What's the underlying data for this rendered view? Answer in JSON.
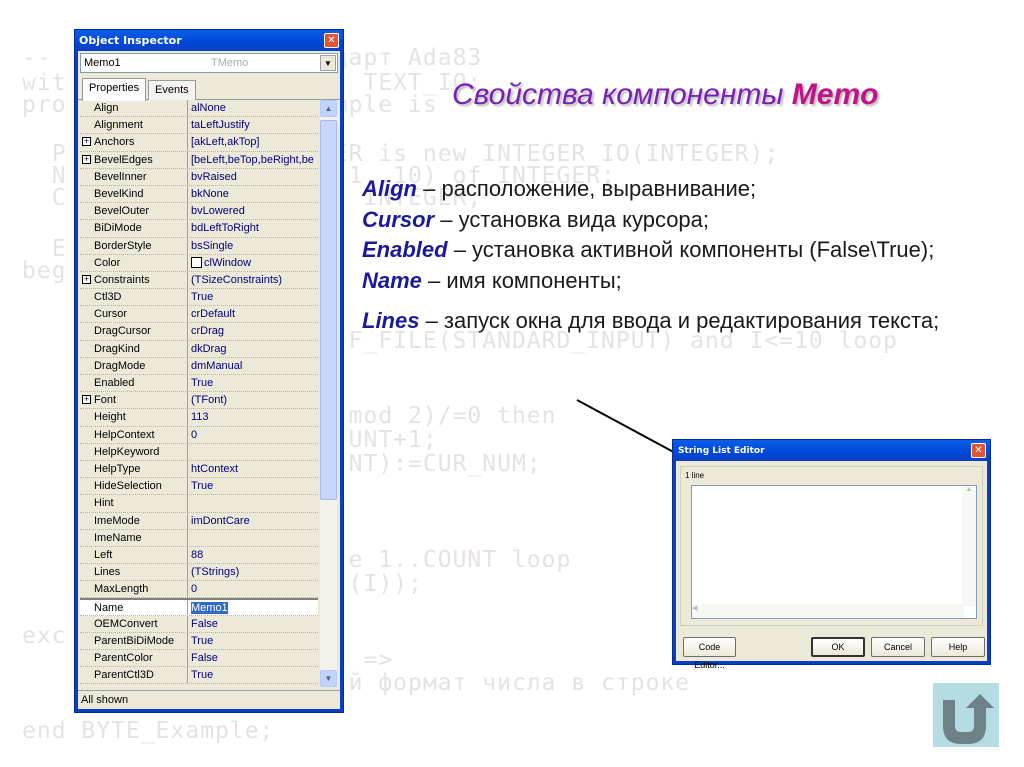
{
  "background_code": [
    "-- Используется стандарт Ada83",
    "with ADA.TEXT_IO; use ADA.TEXT_IO;",
    "procedure BYTE_Example is",
    "  package INT_IO is new INTEGER_IO(INTEGER);",
    "  NUMS: array (1..10) of INTEGER;",
    "  CUR_NUM: INTEGER;",
    "  E",
    "begin",
    "  while not END_OF_FILE(STANDARD_INPUT) and I<=10 loop",
    "    if (CUR_NUM mod 2)/=0 then",
    "      COUNT:=COUNT+1;",
    "      NUMS(COUNT):=CUR_NUM;",
    "    for I in reverse 1..COUNT loop",
    "      PUT(NUMS(I));",
    "exception",
    "  when DATA_ERROR =>",
    "    PUT_LINE(\"Неверный формат числа в строке\");",
    "end BYTE_Example;"
  ],
  "object_inspector": {
    "title": "Object Inspector",
    "close_glyph": "✕",
    "component_name": "Memo1",
    "component_type": "TMemo",
    "dropdown_glyph": "▼",
    "tabs": [
      "Properties",
      "Events"
    ],
    "active_tab": "Properties",
    "status": "All shown",
    "properties": [
      {
        "name": "Align",
        "value": "alNone",
        "expandable": false
      },
      {
        "name": "Alignment",
        "value": "taLeftJustify",
        "expandable": false
      },
      {
        "name": "Anchors",
        "value": "[akLeft,akTop]",
        "expandable": true
      },
      {
        "name": "BevelEdges",
        "value": "[beLeft,beTop,beRight,be",
        "expandable": true
      },
      {
        "name": "BevelInner",
        "value": "bvRaised",
        "expandable": false
      },
      {
        "name": "BevelKind",
        "value": "bkNone",
        "expandable": false
      },
      {
        "name": "BevelOuter",
        "value": "bvLowered",
        "expandable": false
      },
      {
        "name": "BiDiMode",
        "value": "bdLeftToRight",
        "expandable": false
      },
      {
        "name": "BorderStyle",
        "value": "bsSingle",
        "expandable": false
      },
      {
        "name": "Color",
        "value": "clWindow",
        "expandable": false,
        "swatch": "#ffffff"
      },
      {
        "name": "Constraints",
        "value": "(TSizeConstraints)",
        "expandable": true
      },
      {
        "name": "Ctl3D",
        "value": "True",
        "expandable": false
      },
      {
        "name": "Cursor",
        "value": "crDefault",
        "expandable": false
      },
      {
        "name": "DragCursor",
        "value": "crDrag",
        "expandable": false
      },
      {
        "name": "DragKind",
        "value": "dkDrag",
        "expandable": false
      },
      {
        "name": "DragMode",
        "value": "dmManual",
        "expandable": false
      },
      {
        "name": "Enabled",
        "value": "True",
        "expandable": false
      },
      {
        "name": "Font",
        "value": "(TFont)",
        "expandable": true
      },
      {
        "name": "Height",
        "value": "113",
        "expandable": false
      },
      {
        "name": "HelpContext",
        "value": "0",
        "expandable": false
      },
      {
        "name": "HelpKeyword",
        "value": "",
        "expandable": false
      },
      {
        "name": "HelpType",
        "value": "htContext",
        "expandable": false
      },
      {
        "name": "HideSelection",
        "value": "True",
        "expandable": false
      },
      {
        "name": "Hint",
        "value": "",
        "expandable": false
      },
      {
        "name": "ImeMode",
        "value": "imDontCare",
        "expandable": false
      },
      {
        "name": "ImeName",
        "value": "",
        "expandable": false
      },
      {
        "name": "Left",
        "value": "88",
        "expandable": false
      },
      {
        "name": "Lines",
        "value": "(TStrings)",
        "expandable": false
      },
      {
        "name": "MaxLength",
        "value": "0",
        "expandable": false
      },
      {
        "name": "Name",
        "value": "Memo1",
        "expandable": false,
        "selected": true
      },
      {
        "name": "OEMConvert",
        "value": "False",
        "expandable": false
      },
      {
        "name": "ParentBiDiMode",
        "value": "True",
        "expandable": false
      },
      {
        "name": "ParentColor",
        "value": "False",
        "expandable": false
      },
      {
        "name": "ParentCtl3D",
        "value": "True",
        "expandable": false
      }
    ]
  },
  "slide": {
    "title_prefix": "Свойства компоненты ",
    "title_highlight": "Memo",
    "items": [
      {
        "keyword": "Align",
        "text": " – расположение, выравнивание;"
      },
      {
        "keyword": "Cursor",
        "text": " – установка вида курсора;"
      },
      {
        "keyword": "Enabled",
        "text": " – установка активной компоненты (False\\True);"
      },
      {
        "keyword": "Name",
        "text": " – имя компоненты;"
      },
      {
        "keyword": "Lines",
        "text": " – запуск окна для ввода и редактирования текста;"
      }
    ]
  },
  "string_list_editor": {
    "title": "String List Editor",
    "close_glyph": "✕",
    "line_count": "1 line",
    "buttons": {
      "code_editor": "Code Editor...",
      "ok": "OK",
      "cancel": "Cancel",
      "help": "Help"
    }
  },
  "navigation": {
    "back_icon": "return-arrow-icon"
  }
}
